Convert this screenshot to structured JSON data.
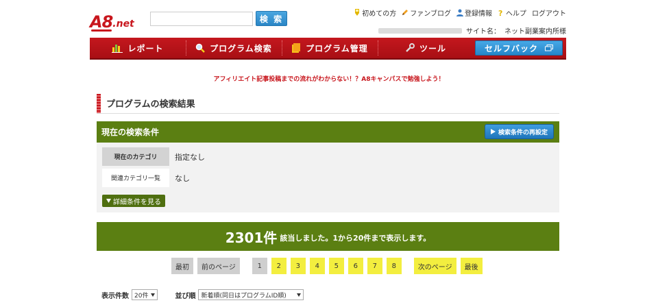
{
  "header": {
    "logo_main": "A8",
    "logo_suffix": ".net",
    "search_button": "検 索",
    "search_value": "",
    "links": [
      {
        "label": "初めての方",
        "icon": "badge-icon"
      },
      {
        "label": "ファンブログ",
        "icon": "pencil-icon"
      },
      {
        "label": "登録情報",
        "icon": "user-icon"
      },
      {
        "label": "ヘルプ",
        "icon": "help-icon"
      },
      {
        "label": "ログアウト",
        "icon": ""
      }
    ],
    "site_label": "サイト名：",
    "site_name": "ネット副業案内所様"
  },
  "nav": {
    "items": [
      {
        "label": "レポート",
        "icon": "bar-chart-icon"
      },
      {
        "label": "プログラム検索",
        "icon": "magnifier-icon"
      },
      {
        "label": "プログラム管理",
        "icon": "folder-icon"
      },
      {
        "label": "ツール",
        "icon": "wrench-icon"
      }
    ],
    "selfback": "セルフバック",
    "selfback_icon": "external-window-icon"
  },
  "banner": "アフィリエイト記事投稿までの流れがわからない！？A8キャンパスで勉強しよう！",
  "section_title": "プログラムの検索結果",
  "conditions": {
    "title": "現在の検索条件",
    "recondition_button": "検索条件の再設定",
    "rows": [
      {
        "label": "現在のカテゴリ",
        "value": "指定なし"
      },
      {
        "label": "関連カテゴリ一覧",
        "value": "なし"
      }
    ],
    "detail_button": "詳細条件を見る"
  },
  "result": {
    "count": "2301件",
    "text": "該当しました。1から20件まで表示します。"
  },
  "pagination": {
    "first": "最初",
    "prev": "前のページ",
    "pages": [
      "1",
      "2",
      "3",
      "4",
      "5",
      "6",
      "7",
      "8"
    ],
    "current": "1",
    "next": "次のページ",
    "last": "最後"
  },
  "controls": {
    "per_page_label": "表示件数",
    "per_page_value": "20件",
    "sort_label": "並び順",
    "sort_value": "新着順(同日はプログラムID順)"
  },
  "colors": {
    "brand_red": "#c8161d",
    "green": "#5b7f12",
    "blue": "#2b86c6",
    "yellow": "#f3ee3f"
  }
}
